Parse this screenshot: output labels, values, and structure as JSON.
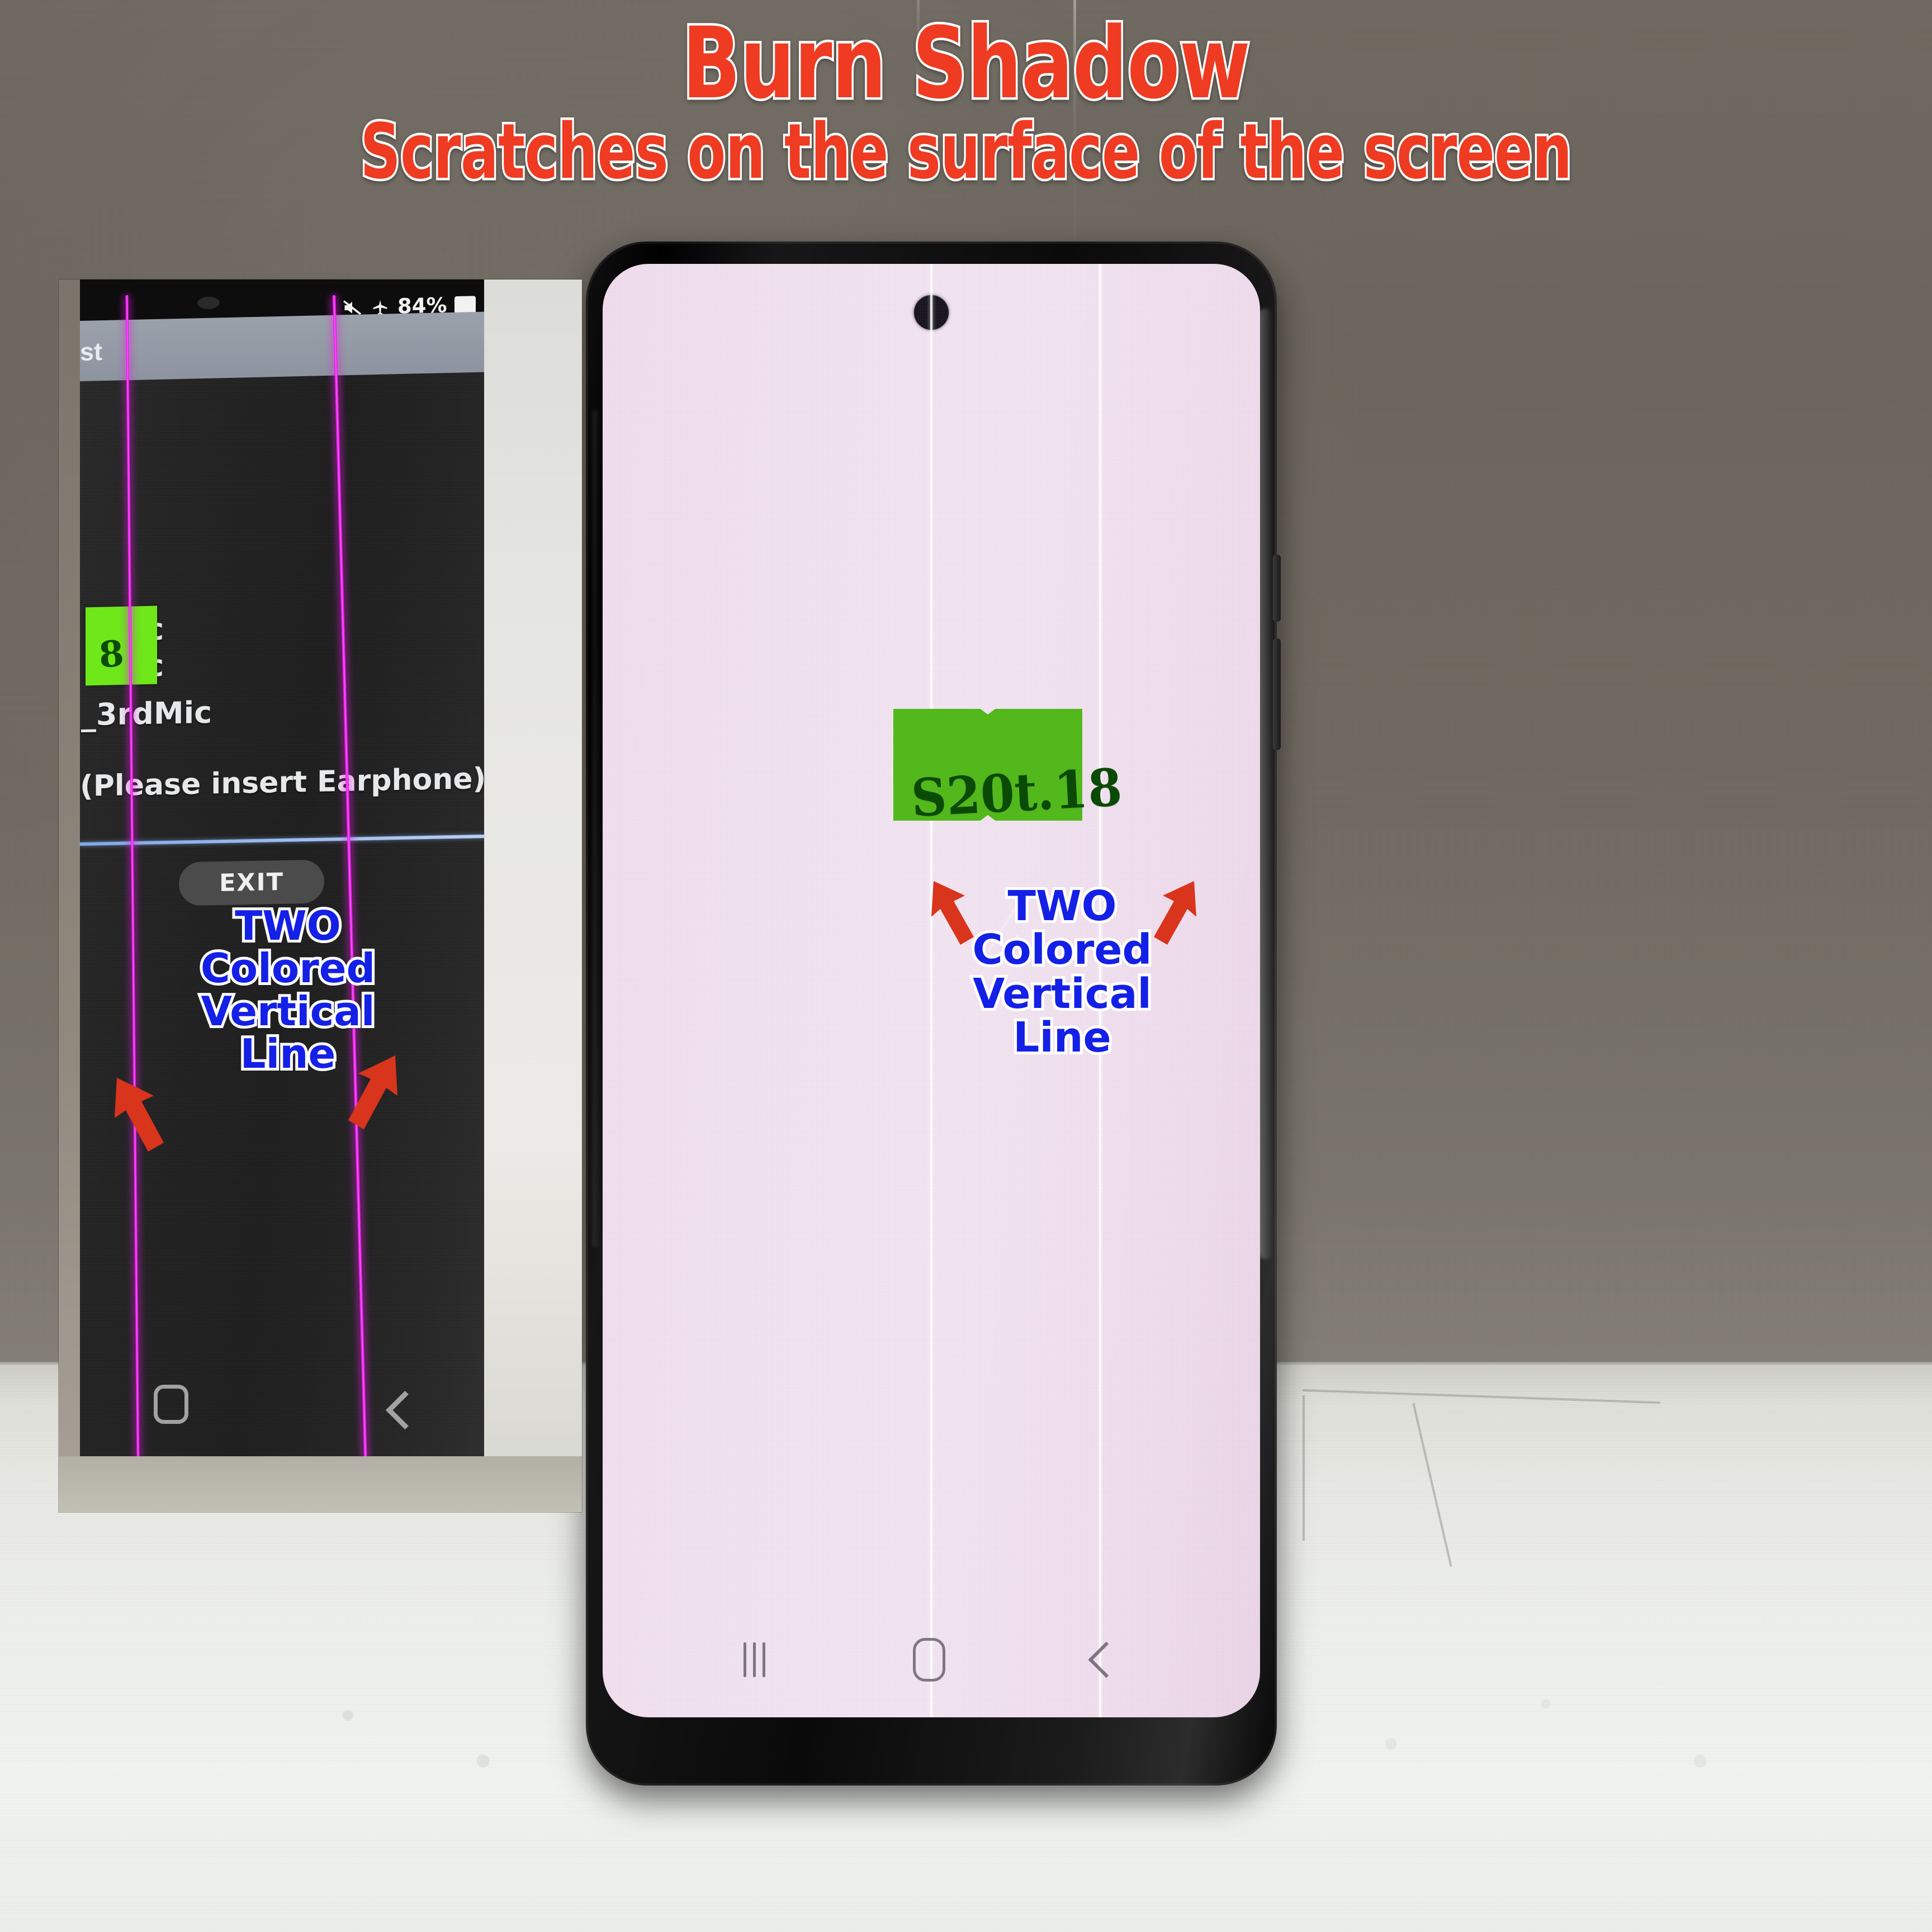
{
  "title": {
    "main": "Burn Shadow",
    "sub": "Scratches on the surface of the screen",
    "color": "#ee3b22",
    "outline_color": "#ffffff"
  },
  "annotation": {
    "color": "#1420e6",
    "outline_color": "#ffffff",
    "arrow_color": "#d9341c",
    "lines": [
      "TWO",
      "Colored",
      "Vertical",
      "Line"
    ]
  },
  "inset_photo": {
    "status_bar": {
      "mute_icon": "mute-icon",
      "airplane_icon": "airplane-mode-icon",
      "battery_text": "84%",
      "battery_icon": "battery-icon"
    },
    "app_bar": {
      "title": "st"
    },
    "list_items": [
      "Mic",
      "Mic",
      "_3rdMic",
      "(Please insert Earphone)"
    ],
    "sticker_text": "8",
    "exit_button": "EXIT",
    "nav": {
      "home_icon": "home-icon",
      "back_icon": "back-icon"
    },
    "defect_color": "#e81ae8",
    "defect_count": 2
  },
  "phone": {
    "screen_color": "#f2e2f0",
    "sticker_text": "S20t.18",
    "sticker_color": "#52b81c",
    "punchhole_icon": "front-camera-punchhole-icon",
    "defect_color": "#ffffff",
    "defect_count": 2,
    "nav": {
      "recents_icon": "recents-icon",
      "home_icon": "home-icon",
      "back_icon": "back-icon"
    }
  }
}
